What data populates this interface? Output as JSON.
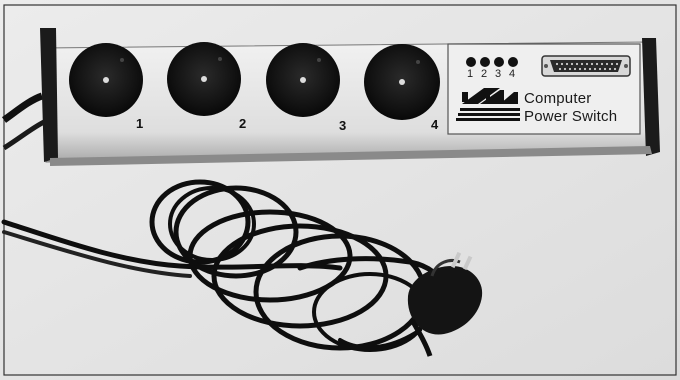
{
  "photo": {
    "subject": "power-strip",
    "sockets": [
      {
        "label": "1"
      },
      {
        "label": "2"
      },
      {
        "label": "3"
      },
      {
        "label": "4"
      }
    ],
    "indicators": [
      {
        "label": "1"
      },
      {
        "label": "2"
      },
      {
        "label": "3"
      },
      {
        "label": "4"
      }
    ],
    "brand": {
      "logo_icon": "striped-m-logo-icon",
      "line1": "Computer",
      "line2": "Power Switch"
    }
  }
}
